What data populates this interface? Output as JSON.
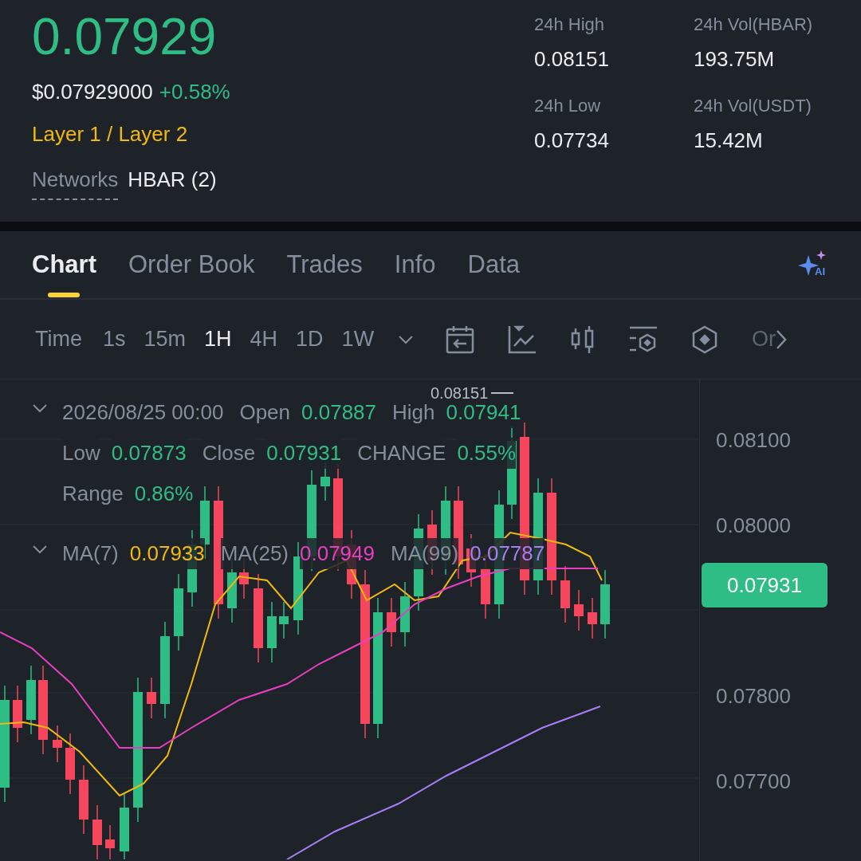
{
  "ticker": {
    "price": "0.07929",
    "usd_price": "$0.07929000",
    "change": "+0.58%",
    "category": "Layer 1 / Layer 2",
    "networks_label": "Networks",
    "networks_value": "HBAR (2)"
  },
  "stats": [
    {
      "label": "24h High",
      "value": "0.08151"
    },
    {
      "label": "24h Vol(HBAR)",
      "value": "193.75M"
    },
    {
      "label": "24h Low",
      "value": "0.07734"
    },
    {
      "label": "24h Vol(USDT)",
      "value": "15.42M"
    }
  ],
  "tabs": [
    {
      "label": "Chart",
      "selected": true
    },
    {
      "label": "Order Book",
      "selected": false
    },
    {
      "label": "Trades",
      "selected": false
    },
    {
      "label": "Info",
      "selected": false
    },
    {
      "label": "Data",
      "selected": false
    }
  ],
  "ai_button": {
    "label": "AI"
  },
  "toolbar": {
    "label": "Time",
    "intervals": [
      {
        "label": "1s",
        "selected": false
      },
      {
        "label": "15m",
        "selected": false
      },
      {
        "label": "1H",
        "selected": true
      },
      {
        "label": "4H",
        "selected": false
      },
      {
        "label": "1D",
        "selected": false
      },
      {
        "label": "1W",
        "selected": false
      }
    ],
    "more_label": "Or"
  },
  "legend": {
    "rows": [
      [
        {
          "label": "2026/08/25 00:00"
        },
        {
          "label": "Open",
          "value": "0.07887"
        },
        {
          "label": "High",
          "value": "0.07941"
        }
      ],
      [
        {
          "label": "Low",
          "value": "0.07873"
        },
        {
          "label": "Close",
          "value": "0.07931"
        },
        {
          "label": "CHANGE",
          "value": "0.55%"
        }
      ],
      [
        {
          "label": "Range",
          "value": "0.86%"
        }
      ]
    ],
    "ma": [
      {
        "label": "MA(7)",
        "value": "0.07933",
        "color": "#f0b90b"
      },
      {
        "label": "MA(25)",
        "value": "0.07949",
        "color": "#e83fc0"
      },
      {
        "label": "MA(99)",
        "value": "0.07787",
        "color": "#a77ef5"
      }
    ]
  },
  "chart": {
    "high_marker": "0.08151",
    "price_labels": [
      "0.08100",
      "0.08000",
      "0.07800",
      "0.07700"
    ],
    "current_price": "0.07931"
  }
}
